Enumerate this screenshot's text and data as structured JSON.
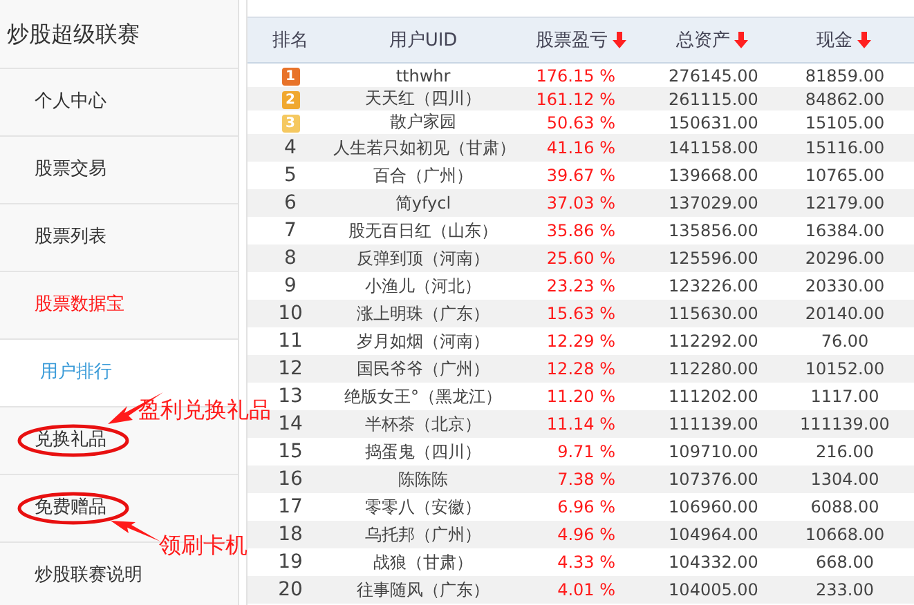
{
  "sidebar": {
    "title": "炒股超级联赛",
    "items": [
      {
        "label": "个人中心",
        "kind": "item",
        "circled": false
      },
      {
        "label": "股票交易",
        "kind": "item",
        "circled": false
      },
      {
        "label": "股票列表",
        "kind": "item",
        "circled": false
      },
      {
        "label": "股票数据宝",
        "kind": "current",
        "circled": false
      },
      {
        "label": "用户排行",
        "kind": "sub",
        "circled": false
      },
      {
        "label": "兑换礼品",
        "kind": "item",
        "circled": true
      },
      {
        "label": "免费赠品",
        "kind": "item",
        "circled": true
      },
      {
        "label": "炒股联赛说明",
        "kind": "item",
        "circled": false
      }
    ]
  },
  "table": {
    "columns": [
      {
        "label": "排名",
        "sortable": false
      },
      {
        "label": "用户UID",
        "sortable": false
      },
      {
        "label": "股票盈亏",
        "sortable": true
      },
      {
        "label": "总资产",
        "sortable": true
      },
      {
        "label": "现金",
        "sortable": true
      }
    ],
    "rows": [
      {
        "kind": "medal",
        "color": "#e8732a",
        "rank": "1",
        "uid": "tthwhr",
        "profit": "176.15 %",
        "total": "276145.00",
        "cash": "81859.00"
      },
      {
        "kind": "medal",
        "color": "#f0a830",
        "rank": "2",
        "uid": "天天红（四川）",
        "profit": "161.12 %",
        "total": "261115.00",
        "cash": "84862.00"
      },
      {
        "kind": "medal",
        "color": "#f5c860",
        "rank": "3",
        "uid": "散户家园",
        "profit": "50.63 %",
        "total": "150631.00",
        "cash": "15105.00"
      },
      {
        "kind": "plain",
        "rank": "4",
        "uid": "人生若只如初见（甘肃）",
        "profit": "41.16 %",
        "total": "141158.00",
        "cash": "15116.00"
      },
      {
        "kind": "plain",
        "rank": "5",
        "uid": "百合（广州）",
        "profit": "39.67 %",
        "total": "139668.00",
        "cash": "10765.00"
      },
      {
        "kind": "plain",
        "rank": "6",
        "uid": "简yfycl",
        "profit": "37.03 %",
        "total": "137029.00",
        "cash": "12179.00"
      },
      {
        "kind": "plain",
        "rank": "7",
        "uid": "股无百日红（山东）",
        "profit": "35.86 %",
        "total": "135856.00",
        "cash": "16384.00"
      },
      {
        "kind": "plain",
        "rank": "8",
        "uid": "反弹到顶（河南）",
        "profit": "25.60 %",
        "total": "125596.00",
        "cash": "20296.00"
      },
      {
        "kind": "plain",
        "rank": "9",
        "uid": "小渔儿（河北）",
        "profit": "23.23 %",
        "total": "123226.00",
        "cash": "20330.00"
      },
      {
        "kind": "plain",
        "rank": "10",
        "uid": "涨上明珠（广东）",
        "profit": "15.63 %",
        "total": "115630.00",
        "cash": "20140.00"
      },
      {
        "kind": "plain",
        "rank": "11",
        "uid": "岁月如烟（河南）",
        "profit": "12.29 %",
        "total": "112292.00",
        "cash": "76.00"
      },
      {
        "kind": "plain",
        "rank": "12",
        "uid": "国民爷爷（广州）",
        "profit": "12.28 %",
        "total": "112280.00",
        "cash": "10152.00"
      },
      {
        "kind": "plain",
        "rank": "13",
        "uid": "绝版女王°（黑龙江）",
        "profit": "11.20 %",
        "total": "111202.00",
        "cash": "1117.00"
      },
      {
        "kind": "plain",
        "rank": "14",
        "uid": "半杯茶（北京）",
        "profit": "11.14 %",
        "total": "111139.00",
        "cash": "111139.00"
      },
      {
        "kind": "plain",
        "rank": "15",
        "uid": "捣蛋鬼（四川）",
        "profit": "9.71 %",
        "total": "109710.00",
        "cash": "216.00"
      },
      {
        "kind": "plain",
        "rank": "16",
        "uid": "陈陈陈",
        "profit": "7.38 %",
        "total": "107376.00",
        "cash": "1304.00"
      },
      {
        "kind": "plain",
        "rank": "17",
        "uid": "零零八（安徽）",
        "profit": "6.96 %",
        "total": "106960.00",
        "cash": "6088.00"
      },
      {
        "kind": "plain",
        "rank": "18",
        "uid": "乌托邦（广州）",
        "profit": "4.96 %",
        "total": "104964.00",
        "cash": "10668.00"
      },
      {
        "kind": "plain",
        "rank": "19",
        "uid": "战狼（甘肃）",
        "profit": "4.33 %",
        "total": "104332.00",
        "cash": "668.00"
      },
      {
        "kind": "plain",
        "rank": "20",
        "uid": "往事随风（广东）",
        "profit": "4.01 %",
        "total": "104005.00",
        "cash": "233.00"
      }
    ]
  },
  "annotations": [
    {
      "text": "盈利兑换礼品"
    },
    {
      "text": "领刷卡机"
    }
  ]
}
